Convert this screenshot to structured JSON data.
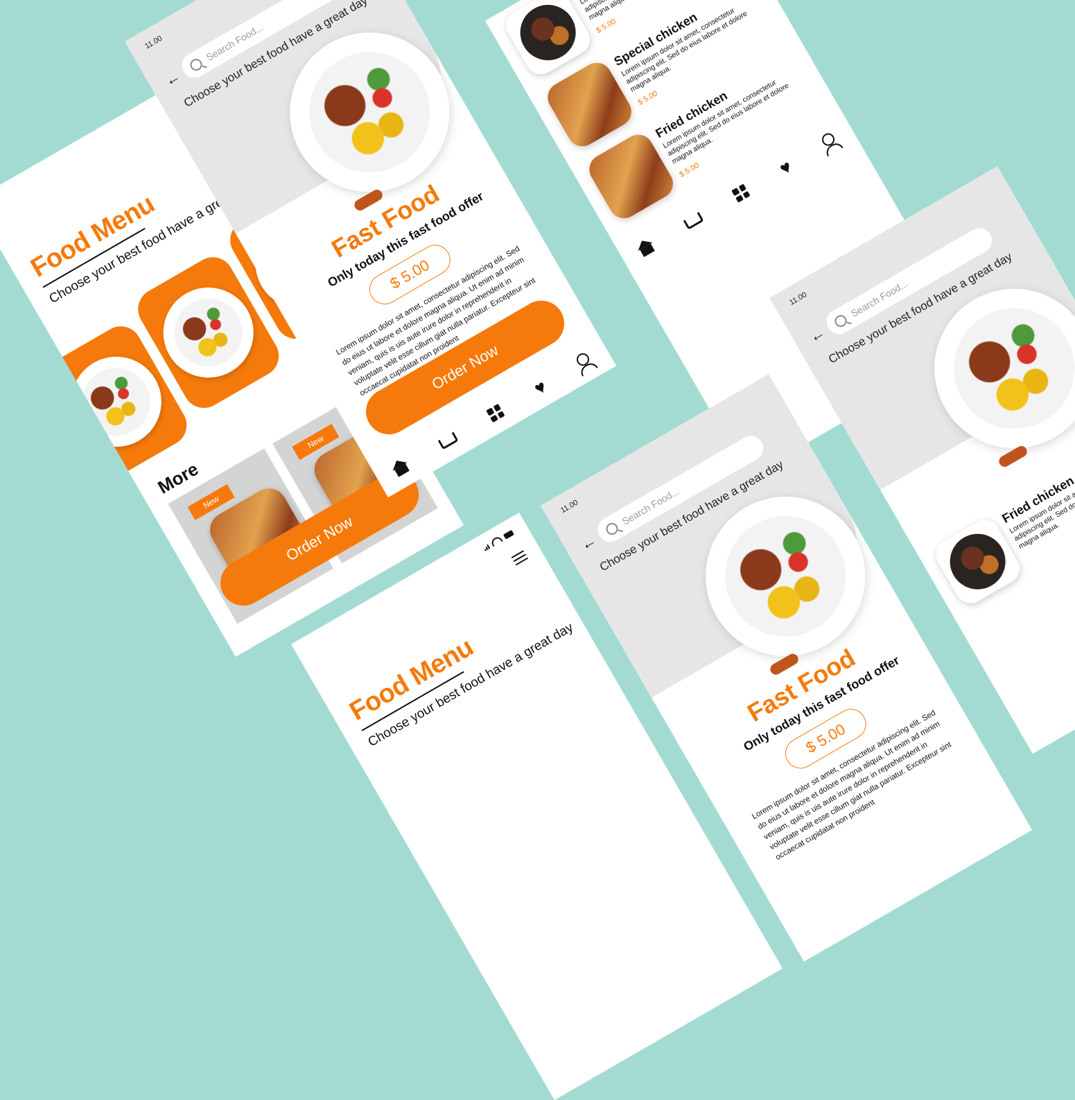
{
  "status": {
    "time": "11.00"
  },
  "menu": {
    "title": "Food Menu",
    "subtitle": "Choose your best food  have a great day",
    "more": "More",
    "badge": "New",
    "order": "Order Now"
  },
  "detail": {
    "search_placeholder": "Search Food...",
    "hero_subtitle": "Choose your best food have a great day",
    "title": "Fast Food",
    "offer": "Only today this fast food offer",
    "price": "$ 5.00",
    "lorem": "Lorem ipsum dolor sit amet, consectetur adipiscing elit. Sed do eius ut labore et dolore magna aliqua. Ut enim ad minim veniam, quis is uis aute irure dolor in reprehenderit in voluptate velit esse cillum giat nulla pariatur. Excepteur sint occaecat cupidatat non proident",
    "order": "Order Now"
  },
  "list": {
    "items": [
      {
        "name": "Fried chicken",
        "desc": "Lorem ipsum dolor sit amet, consectetur adipiscing elit. Sed do eius labore et dolore magna aliqua.",
        "price": "$ 5.00"
      },
      {
        "name": "Special chicken",
        "desc": "Lorem ipsum dolor sit amet, consectetur adipiscing elit. Sed do eius labore et dolore magna aliqua.",
        "price": "$ 5.00"
      },
      {
        "name": "Fried chicken",
        "desc": "Lorem ipsum dolor sit amet, consectetur adipiscing elit. Sed do eius labore et dolore magna aliqua.",
        "price": "$ 5.00"
      }
    ]
  },
  "icons": {
    "back": "back-arrow-icon",
    "search": "search-icon",
    "menu": "hamburger-icon",
    "home": "home-icon",
    "cart": "cart-icon",
    "grid": "grid-icon",
    "heart": "heart-icon",
    "user": "user-icon"
  },
  "colors": {
    "accent": "#f57a0b",
    "background": "#a3dbd3",
    "hero": "#e6e6e6"
  }
}
